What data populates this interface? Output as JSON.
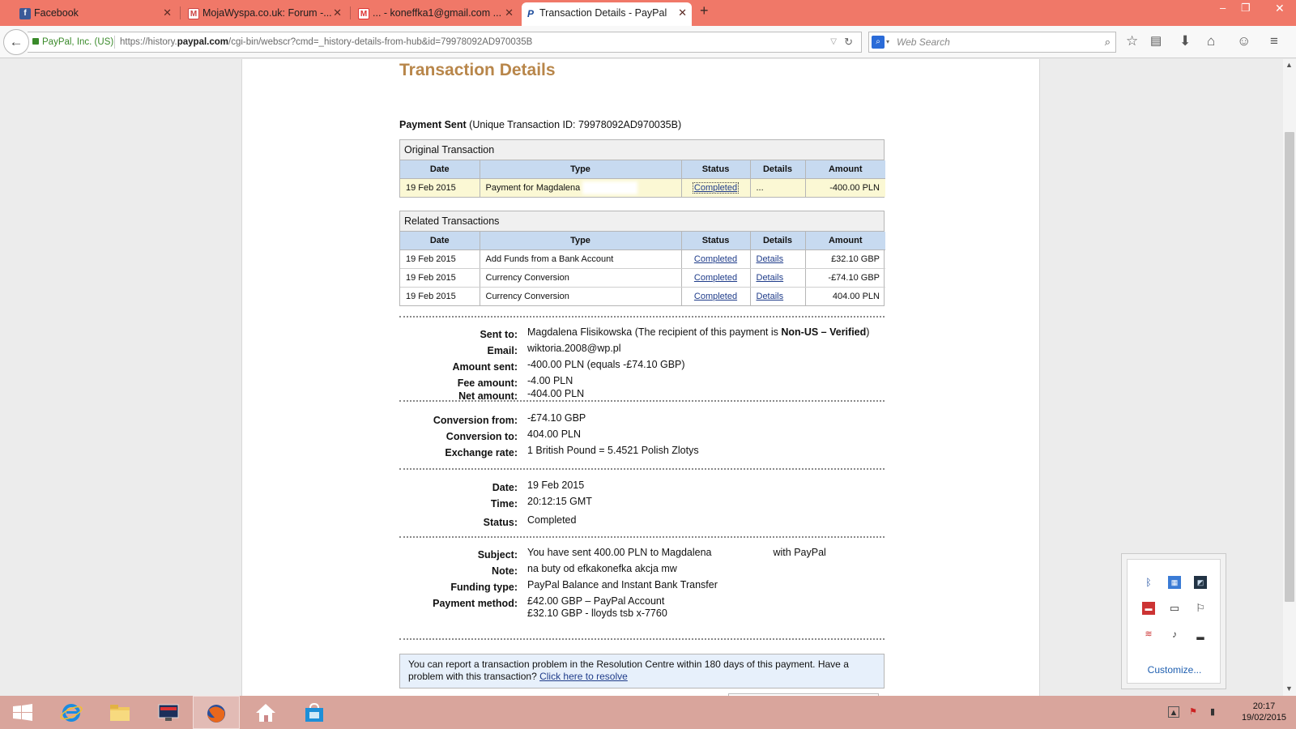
{
  "browser": {
    "tabs": [
      {
        "label": "Facebook",
        "favicon": "facebook-icon",
        "active": false
      },
      {
        "label": "MojaWyspa.co.uk: Forum -...",
        "favicon": "mojawyspa-icon",
        "active": false
      },
      {
        "label": "... - koneffka1@gmail.com ...",
        "favicon": "gmail-icon",
        "active": false
      },
      {
        "label": "Transaction Details - PayPal",
        "favicon": "paypal-icon",
        "active": true
      }
    ],
    "site_identity": "PayPal, Inc. (US)",
    "url_prefix": "https://history.",
    "url_host": "paypal.com",
    "url_path": "/cgi-bin/webscr?cmd=_history-details-from-hub&id=79978092AD970035B",
    "search_placeholder": "Web Search"
  },
  "page": {
    "title": "Transaction Details",
    "payment_sent_label": "Payment Sent",
    "payment_sent_id": "(Unique Transaction ID: 79978092AD970035B)",
    "original": {
      "caption": "Original Transaction",
      "headers": [
        "Date",
        "Type",
        "Status",
        "Details",
        "Amount"
      ],
      "rows": [
        {
          "date": "19 Feb 2015",
          "type": "Payment for Magdalena",
          "status": "Completed",
          "details": "...",
          "amount": "-400.00 PLN"
        }
      ]
    },
    "related": {
      "caption": "Related Transactions",
      "headers": [
        "Date",
        "Type",
        "Status",
        "Details",
        "Amount"
      ],
      "rows": [
        {
          "date": "19 Feb 2015",
          "type": "Add Funds from a Bank Account",
          "status": "Completed",
          "details": "Details",
          "amount": "£32.10 GBP"
        },
        {
          "date": "19 Feb 2015",
          "type": "Currency Conversion",
          "status": "Completed",
          "details": "Details",
          "amount": "-£74.10 GBP"
        },
        {
          "date": "19 Feb 2015",
          "type": "Currency Conversion",
          "status": "Completed",
          "details": "Details",
          "amount": "404.00 PLN"
        }
      ]
    },
    "sent_to": {
      "label": "Sent to:",
      "name": "Magdalena Flisikowska",
      "note_pre": "(The recipient of this payment is",
      "note_bold": "Non-US – Verified",
      "note_post": ")"
    },
    "email": {
      "label": "Email:",
      "value": "wiktoria.2008@wp.pl"
    },
    "amount_sent": {
      "label": "Amount sent:",
      "value": "-400.00 PLN (equals -£74.10 GBP)"
    },
    "fee_amount": {
      "label": "Fee amount:",
      "value": "-4.00 PLN"
    },
    "net_amount": {
      "label": "Net amount:",
      "value": "-404.00 PLN"
    },
    "conversion_from": {
      "label": "Conversion from:",
      "value": "-£74.10 GBP"
    },
    "conversion_to": {
      "label": "Conversion to:",
      "value": "404.00 PLN"
    },
    "exchange_rate": {
      "label": "Exchange rate:",
      "value": "1 British Pound = 5.4521 Polish Zlotys"
    },
    "date": {
      "label": "Date:",
      "value": "19 Feb 2015"
    },
    "time": {
      "label": "Time:",
      "value": "20:12:15 GMT"
    },
    "status": {
      "label": "Status:",
      "value": "Completed"
    },
    "subject": {
      "label": "Subject:",
      "value_pre": "You have sent 400.00 PLN to Magdalena",
      "value_post": "with PayPal"
    },
    "note": {
      "label": "Note:",
      "value": "na buty od efkakonefka akcja mw"
    },
    "funding_type": {
      "label": "Funding type:",
      "value": "PayPal Balance and Instant Bank Transfer"
    },
    "payment_method": {
      "label": "Payment method:",
      "line1": "£42.00 GBP – PayPal Account",
      "line2": "£32.10 GBP - lloyds tsb x-7760"
    },
    "notice_text": "You can report a transaction problem in the Resolution Centre within 180 days of this payment. Have a problem with this transaction?",
    "notice_link": "Click here to resolve"
  },
  "tray": {
    "customize_label": "Customize..."
  },
  "taskbar": {
    "clock_time": "20:17",
    "clock_date": "19/02/2015"
  },
  "colors": {
    "title_orange": "#b8864a",
    "table_header_blue": "#c7daf0",
    "highlight_row": "#fbf8d4",
    "tabbar": "#f07868"
  }
}
